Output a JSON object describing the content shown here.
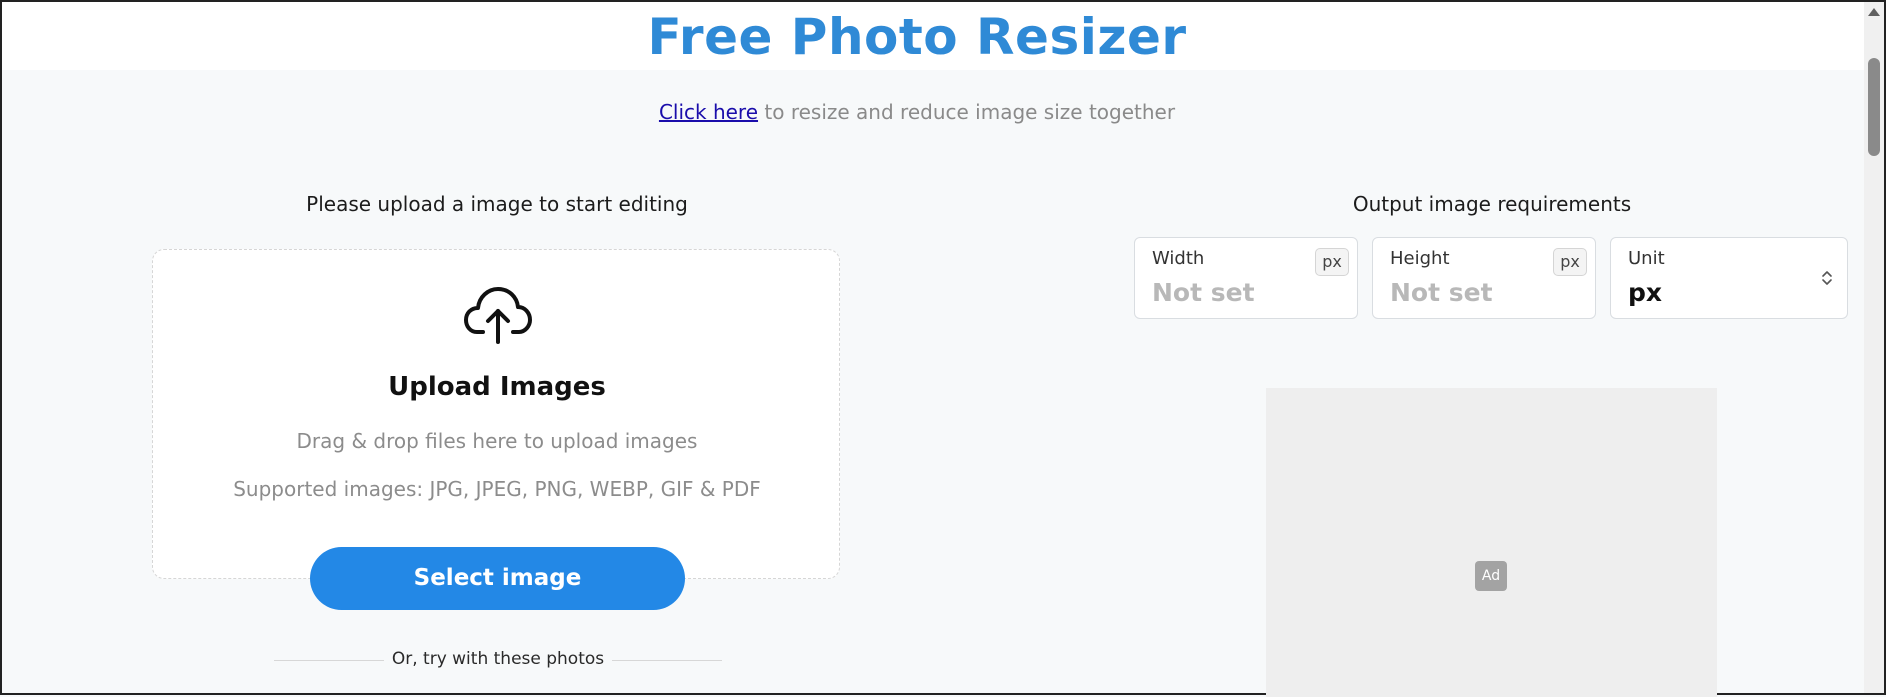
{
  "header": {
    "title": "Free Photo Resizer"
  },
  "promo": {
    "link_text": "Click here",
    "rest_text": " to resize and reduce image size together"
  },
  "upload": {
    "heading": "Please upload a image to start editing",
    "title": "Upload Images",
    "hint_drag": "Drag & drop files here to upload images",
    "hint_supported": "Supported images: JPG, JPEG, PNG, WEBP, GIF & PDF",
    "button_label": "Select image",
    "or_text": "Or, try with these photos",
    "icon": "cloud-upload-icon"
  },
  "output": {
    "heading": "Output image requirements",
    "width": {
      "label": "Width",
      "value": "Not set",
      "unit_badge": "px"
    },
    "height": {
      "label": "Height",
      "value": "Not set",
      "unit_badge": "px"
    },
    "unit": {
      "label": "Unit",
      "value": "px",
      "icon": "select-chevron-icon"
    }
  },
  "ad": {
    "badge": "Ad"
  },
  "colors": {
    "title": "#2f8ad6",
    "button": "#2388e6",
    "page_bg": "#f7f9fa"
  }
}
